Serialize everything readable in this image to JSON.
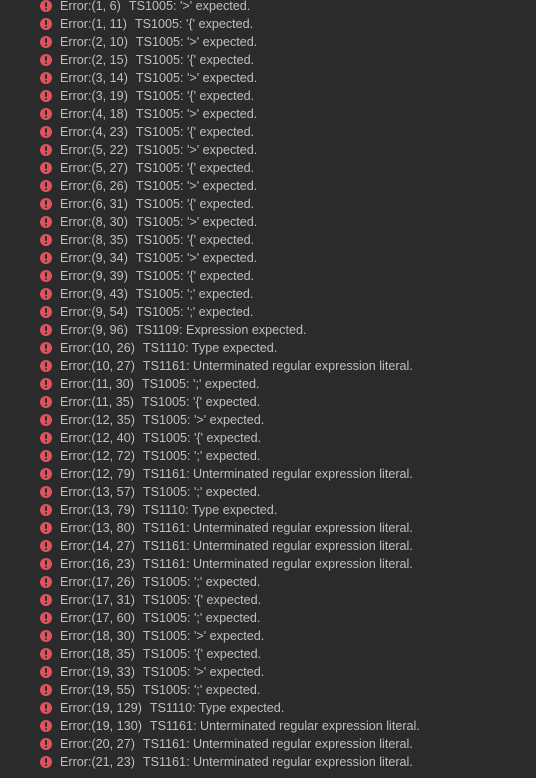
{
  "colors": {
    "background": "#2b2b2b",
    "text": "#bfbfbf",
    "error_icon": "#e0535e"
  },
  "icon": "error-icon",
  "errors": [
    {
      "location": "Error:(1, 6)",
      "message": "TS1005: '>' expected."
    },
    {
      "location": "Error:(1, 11)",
      "message": "TS1005: '{' expected."
    },
    {
      "location": "Error:(2, 10)",
      "message": "TS1005: '>' expected."
    },
    {
      "location": "Error:(2, 15)",
      "message": "TS1005: '{' expected."
    },
    {
      "location": "Error:(3, 14)",
      "message": "TS1005: '>' expected."
    },
    {
      "location": "Error:(3, 19)",
      "message": "TS1005: '{' expected."
    },
    {
      "location": "Error:(4, 18)",
      "message": "TS1005: '>' expected."
    },
    {
      "location": "Error:(4, 23)",
      "message": "TS1005: '{' expected."
    },
    {
      "location": "Error:(5, 22)",
      "message": "TS1005: '>' expected."
    },
    {
      "location": "Error:(5, 27)",
      "message": "TS1005: '{' expected."
    },
    {
      "location": "Error:(6, 26)",
      "message": "TS1005: '>' expected."
    },
    {
      "location": "Error:(6, 31)",
      "message": "TS1005: '{' expected."
    },
    {
      "location": "Error:(8, 30)",
      "message": "TS1005: '>' expected."
    },
    {
      "location": "Error:(8, 35)",
      "message": "TS1005: '{' expected."
    },
    {
      "location": "Error:(9, 34)",
      "message": "TS1005: '>' expected."
    },
    {
      "location": "Error:(9, 39)",
      "message": "TS1005: '{' expected."
    },
    {
      "location": "Error:(9, 43)",
      "message": "TS1005: ';' expected."
    },
    {
      "location": "Error:(9, 54)",
      "message": "TS1005: ';' expected."
    },
    {
      "location": "Error:(9, 96)",
      "message": "TS1109: Expression expected."
    },
    {
      "location": "Error:(10, 26)",
      "message": "TS1110: Type expected."
    },
    {
      "location": "Error:(10, 27)",
      "message": "TS1161: Unterminated regular expression literal."
    },
    {
      "location": "Error:(11, 30)",
      "message": "TS1005: ';' expected."
    },
    {
      "location": "Error:(11, 35)",
      "message": "TS1005: '{' expected."
    },
    {
      "location": "Error:(12, 35)",
      "message": "TS1005: '>' expected."
    },
    {
      "location": "Error:(12, 40)",
      "message": "TS1005: '{' expected."
    },
    {
      "location": "Error:(12, 72)",
      "message": "TS1005: ';' expected."
    },
    {
      "location": "Error:(12, 79)",
      "message": "TS1161: Unterminated regular expression literal."
    },
    {
      "location": "Error:(13, 57)",
      "message": "TS1005: ';' expected."
    },
    {
      "location": "Error:(13, 79)",
      "message": "TS1110: Type expected."
    },
    {
      "location": "Error:(13, 80)",
      "message": "TS1161: Unterminated regular expression literal."
    },
    {
      "location": "Error:(14, 27)",
      "message": "TS1161: Unterminated regular expression literal."
    },
    {
      "location": "Error:(16, 23)",
      "message": "TS1161: Unterminated regular expression literal."
    },
    {
      "location": "Error:(17, 26)",
      "message": "TS1005: ';' expected."
    },
    {
      "location": "Error:(17, 31)",
      "message": "TS1005: '{' expected."
    },
    {
      "location": "Error:(17, 60)",
      "message": "TS1005: ';' expected."
    },
    {
      "location": "Error:(18, 30)",
      "message": "TS1005: '>' expected."
    },
    {
      "location": "Error:(18, 35)",
      "message": "TS1005: '{' expected."
    },
    {
      "location": "Error:(19, 33)",
      "message": "TS1005: '>' expected."
    },
    {
      "location": "Error:(19, 55)",
      "message": "TS1005: ';' expected."
    },
    {
      "location": "Error:(19, 129)",
      "message": "TS1110: Type expected."
    },
    {
      "location": "Error:(19, 130)",
      "message": "TS1161: Unterminated regular expression literal."
    },
    {
      "location": "Error:(20, 27)",
      "message": "TS1161: Unterminated regular expression literal."
    },
    {
      "location": "Error:(21, 23)",
      "message": "TS1161: Unterminated regular expression literal."
    }
  ]
}
